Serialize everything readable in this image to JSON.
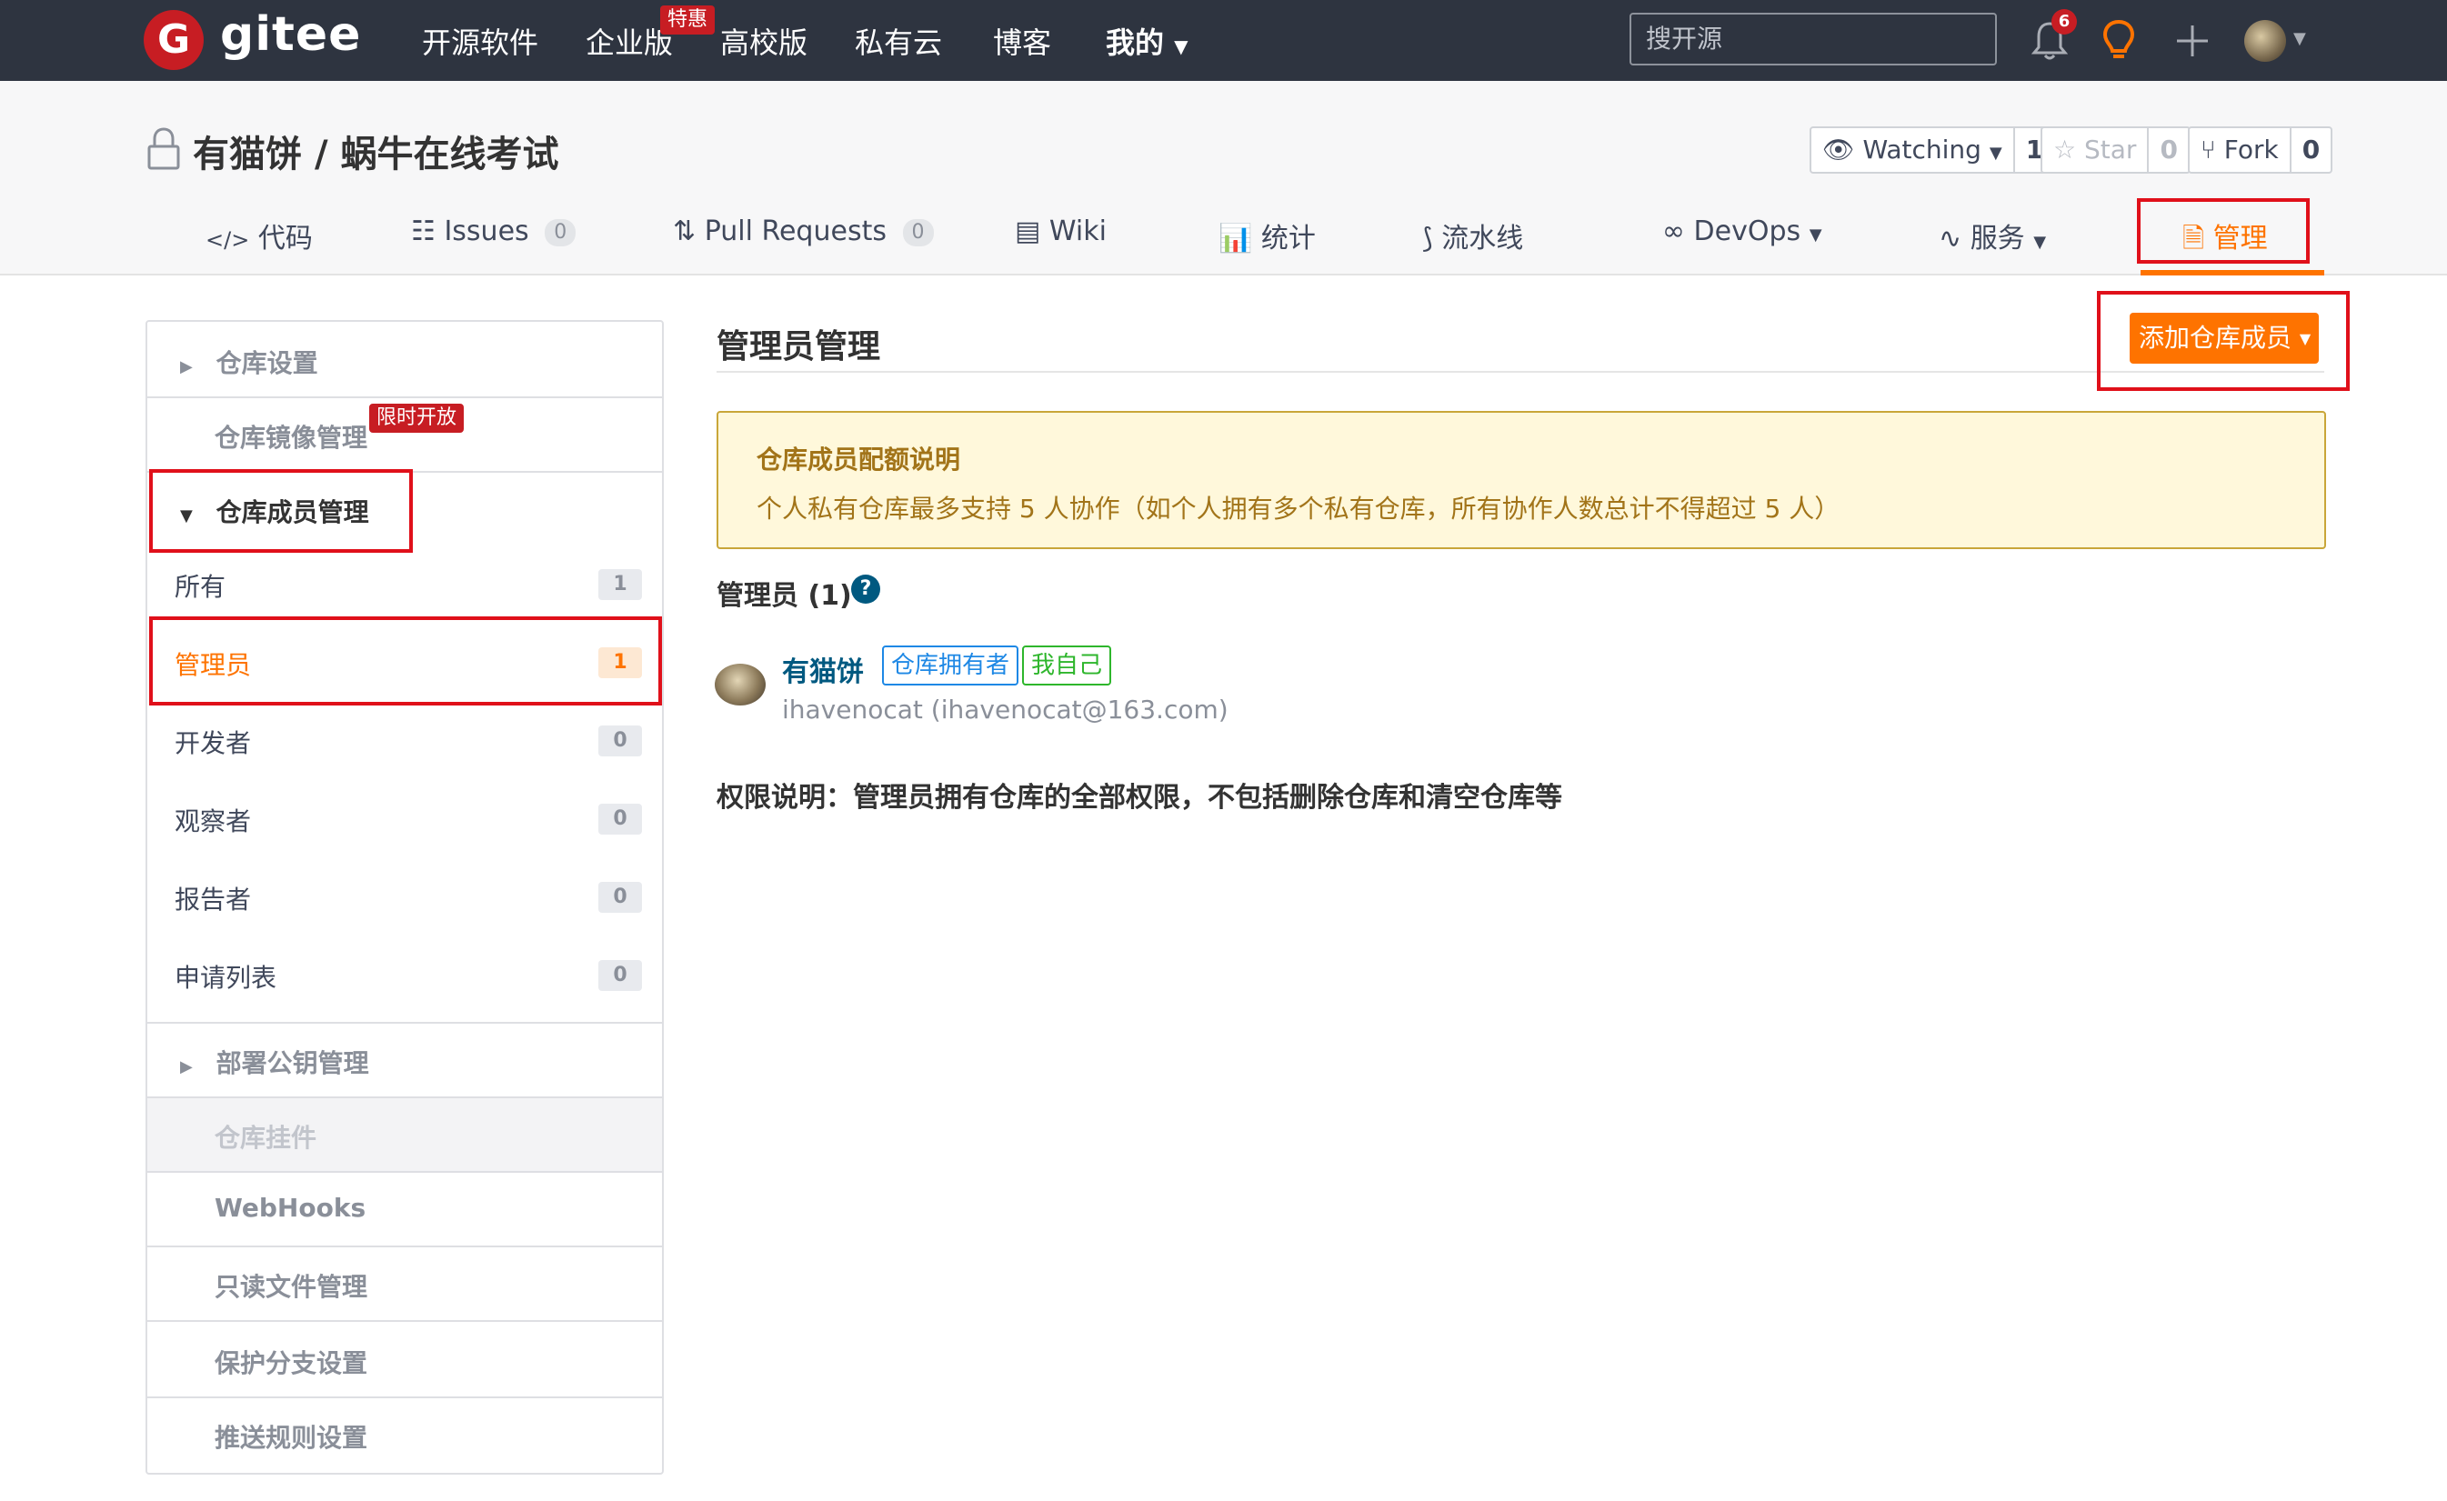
{
  "topnav": {
    "logo_letter": "G",
    "logo_text": "gitee",
    "items": [
      "开源软件",
      "企业版",
      "高校版",
      "私有云",
      "博客",
      "我的"
    ],
    "special_badge": "特惠",
    "search_placeholder": "搜开源",
    "notification_count": "6"
  },
  "repo": {
    "owner": "有猫饼",
    "separator": "/",
    "name": "蜗牛在线考试",
    "watch_label": "Watching",
    "watch_count": "1",
    "star_label": "Star",
    "star_count": "0",
    "fork_label": "Fork",
    "fork_count": "0"
  },
  "tabs": [
    {
      "label": "代码"
    },
    {
      "label": "Issues",
      "count": "0"
    },
    {
      "label": "Pull Requests",
      "count": "0"
    },
    {
      "label": "Wiki"
    },
    {
      "label": "统计"
    },
    {
      "label": "流水线"
    },
    {
      "label": "DevOps"
    },
    {
      "label": "服务"
    },
    {
      "label": "管理"
    }
  ],
  "sidebar": {
    "repo_settings": "仓库设置",
    "mirror": "仓库镜像管理",
    "mirror_badge": "限时开放",
    "members": "仓库成员管理",
    "member_items": [
      {
        "label": "所有",
        "count": "1"
      },
      {
        "label": "管理员",
        "count": "1"
      },
      {
        "label": "开发者",
        "count": "0"
      },
      {
        "label": "观察者",
        "count": "0"
      },
      {
        "label": "报告者",
        "count": "0"
      },
      {
        "label": "申请列表",
        "count": "0"
      }
    ],
    "deploy_keys": "部署公钥管理",
    "plugins": "仓库挂件",
    "webhooks": "WebHooks",
    "readonly": "只读文件管理",
    "protected": "保护分支设置",
    "push_rules": "推送规则设置"
  },
  "main": {
    "title": "管理员管理",
    "add_button": "添加仓库成员",
    "notice_title": "仓库成员配额说明",
    "notice_desc": "个人私有仓库最多支持 5 人协作（如个人拥有多个私有仓库，所有协作人数总计不得超过 5 人）",
    "section_title": "管理员 (1)",
    "member_name": "有猫饼",
    "tag_owner": "仓库拥有者",
    "tag_self": "我自己",
    "member_email": "ihavenocat (ihavenocat@163.com)",
    "permission_note": "权限说明：管理员拥有仓库的全部权限，不包括删除仓库和清空仓库等"
  },
  "colors": {
    "brand": "#c71d23",
    "accent": "#fe7300",
    "nav_bg": "#2e3440",
    "highlight": "#e0101a"
  }
}
